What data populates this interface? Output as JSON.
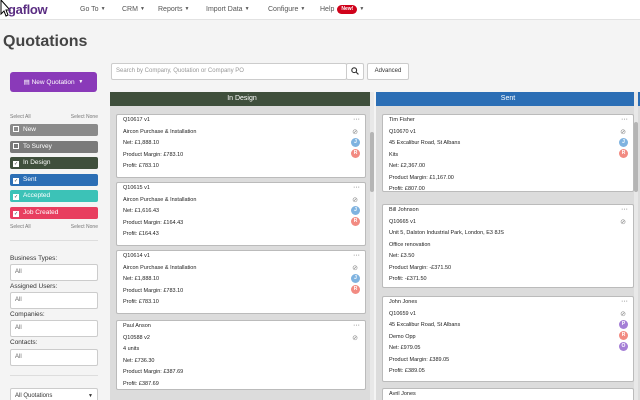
{
  "app": {
    "logo": "gaflow"
  },
  "nav": [
    {
      "label": "Go To"
    },
    {
      "label": "CRM"
    },
    {
      "label": "Reports"
    },
    {
      "label": "Import Data"
    },
    {
      "label": "Configure"
    },
    {
      "label": "Help",
      "badge": "New!"
    }
  ],
  "page": {
    "title": "Quotations"
  },
  "sidebar": {
    "new_quotation": "New Quotation",
    "select_all": "Select All",
    "select_none": "Select None",
    "statuses": [
      {
        "label": "New",
        "checked": false,
        "color": "#8a8a8a"
      },
      {
        "label": "To Survey",
        "checked": false,
        "color": "#7a7a7a"
      },
      {
        "label": "In Design",
        "checked": true,
        "color": "#3f4f3c"
      },
      {
        "label": "Sent",
        "checked": true,
        "color": "#2b6eb5"
      },
      {
        "label": "Accepted",
        "checked": true,
        "color": "#3cc2b7"
      },
      {
        "label": "Job Created",
        "checked": true,
        "color": "#e83e5f"
      }
    ],
    "filters": [
      {
        "label": "Business Types:",
        "value": "All"
      },
      {
        "label": "Assigned Users:",
        "value": "All"
      },
      {
        "label": "Companies:",
        "value": "All"
      },
      {
        "label": "Contacts:",
        "value": "All"
      }
    ],
    "quotations_dropdown": "All Quotations"
  },
  "search": {
    "placeholder": "Search by Company, Quotation or Company PO",
    "advanced": "Advanced"
  },
  "columns": [
    {
      "title": "In Design",
      "color": "#3f4f3c",
      "cards": [
        {
          "lines": [
            "Q10617 v1",
            "Aircon Purchase & Installation",
            "Net: £1,888.10",
            "Product Margin: £783.10",
            "Profit: £783.10"
          ],
          "avatars": [
            {
              "t": "J",
              "c": "#7fb3e0"
            },
            {
              "t": "R",
              "c": "#f28b82"
            }
          ]
        },
        {
          "lines": [
            "Q10615 v1",
            "Aircon Purchase & Installation",
            "Net: £1,616.43",
            "Product Margin: £164.43",
            "Profit: £164.43"
          ],
          "avatars": [
            {
              "t": "J",
              "c": "#7fb3e0"
            },
            {
              "t": "R",
              "c": "#f28b82"
            }
          ]
        },
        {
          "lines": [
            "Q10614 v1",
            "Aircon Purchase & Installation",
            "Net: £1,888.10",
            "Product Margin: £783.10",
            "Profit: £783.10"
          ],
          "avatars": [
            {
              "t": "J",
              "c": "#7fb3e0"
            },
            {
              "t": "R",
              "c": "#f28b82"
            }
          ]
        },
        {
          "lines": [
            "Paul Anson",
            "Q10588 v2",
            "4 units",
            "Net: £736.30",
            "Product Margin: £387.69",
            "Profit: £387.69"
          ],
          "avatars": []
        }
      ]
    },
    {
      "title": "Sent",
      "color": "#2b6eb5",
      "cards": [
        {
          "lines": [
            "Tim Fisher",
            "Q10670 v1",
            "45 Excalibur Road, St Albans",
            "Kits",
            "Net: £2,367.00",
            "Product Margin: £1,167.00",
            "Profit: £807.00"
          ],
          "avatars": [
            {
              "t": "J",
              "c": "#7fb3e0"
            },
            {
              "t": "R",
              "c": "#f28b82"
            }
          ]
        },
        {
          "lines": [
            "Bill Johnson",
            "Q10665 v1",
            "Unit 5, Dalston Industrial Park, London, E3 8JS",
            "Office renovation",
            "Net: £3.50",
            "Product Margin: -£371.50",
            "Profit: -£371.50"
          ],
          "avatars": []
        },
        {
          "lines": [
            "John Jones",
            "Q10659 v1",
            "45 Excalibur Road, St Albans",
            "Demo Opp",
            "Net: £979.05",
            "Product Margin: £389.05",
            "Profit: £389.05"
          ],
          "avatars": [
            {
              "t": "P",
              "c": "#a57fd6"
            },
            {
              "t": "R",
              "c": "#f28b82"
            },
            {
              "t": "O",
              "c": "#a57fd6"
            }
          ]
        },
        {
          "lines": [
            "Avril Jones"
          ],
          "avatars": []
        }
      ]
    }
  ]
}
